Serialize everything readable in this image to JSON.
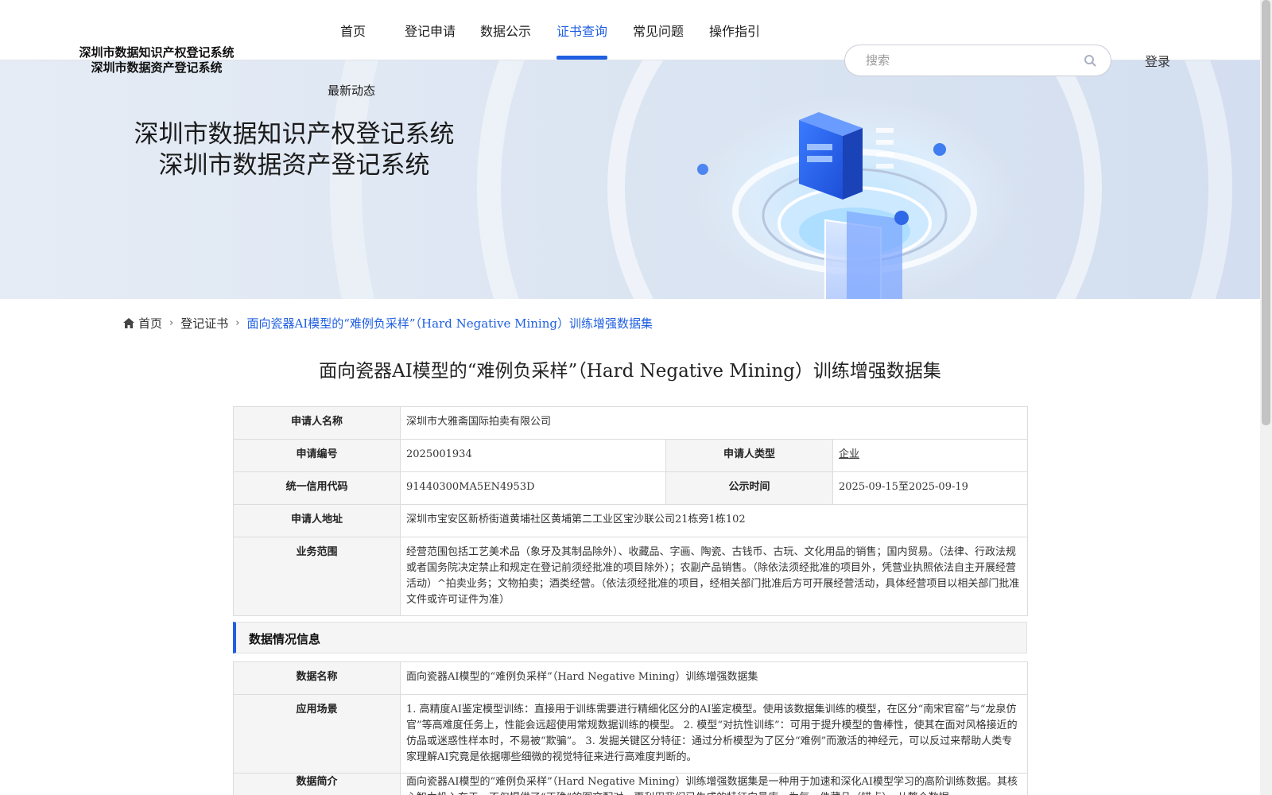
{
  "header": {
    "logo_line1": "深圳市数据知识产权登记系统",
    "logo_line2": "深圳市数据资产登记系统",
    "nav": [
      {
        "label": "首页"
      },
      {
        "label": "登记申请"
      },
      {
        "label": "数据公示"
      },
      {
        "label": "证书查询",
        "active": true
      },
      {
        "label": "常见问题"
      },
      {
        "label": "操作指引"
      }
    ],
    "nav_news": "最新动态",
    "search_placeholder": "搜索",
    "login": "登录"
  },
  "banner": {
    "title_line1": "深圳市数据知识产权登记系统",
    "title_line2": "深圳市数据资产登记系统"
  },
  "breadcrumb": {
    "home": "首页",
    "level2": "登记证书",
    "current": "面向瓷器AI模型的“难例负采样”（Hard Negative Mining）训练增强数据集"
  },
  "title": "面向瓷器AI模型的“难例负采样”（Hard Negative Mining）训练增强数据集",
  "applicant": {
    "name_label": "申请人名称",
    "name": "深圳市大雅斋国际拍卖有限公司",
    "number_label": "申请编号",
    "number": "2025001934",
    "type_label": "申请人类型",
    "type": "企业",
    "credit_label": "统一信用代码",
    "credit": "91440300MA5EN4953D",
    "publicity_label": "公示时间",
    "publicity": "2025-09-15至2025-09-19",
    "address_label": "申请人地址",
    "address": "深圳市宝安区新桥街道黄埔社区黄埔第二工业区宝沙联公司21栋旁1栋102",
    "scope_label": "业务范围",
    "scope": "经营范围包括工艺美术品（象牙及其制品除外）、收藏品、字画、陶瓷、古钱币、古玩、文化用品的销售；国内贸易。（法律、行政法规或者国务院决定禁止和规定在登记前须经批准的项目除外）；农副产品销售。（除依法须经批准的项目外，凭营业执照依法自主开展经营活动）^拍卖业务；文物拍卖；酒类经营。（依法须经批准的项目，经相关部门批准后方可开展经营活动，具体经营项目以相关部门批准文件或许可证件为准）"
  },
  "section": {
    "title": "数据情况信息"
  },
  "data_info": {
    "name_label": "数据名称",
    "name": "面向瓷器AI模型的“难例负采样”（Hard Negative Mining）训练增强数据集",
    "scene_label": "应用场景",
    "scene": "1. 高精度AI鉴定模型训练：直接用于训练需要进行精细化区分的AI鉴定模型。使用该数据集训练的模型，在区分“南宋官窑”与“龙泉仿官”等高难度任务上，性能会远超使用常规数据训练的模型。 2. 模型“对抗性训练”：可用于提升模型的鲁棒性，使其在面对风格接近的仿品或迷惑性样本时，不易被“欺骗”。 3. 发掘关键区分特征：通过分析模型为了区分“难例”而激活的神经元，可以反过来帮助人类专家理解AI究竟是依据哪些细微的视觉特征来进行高难度判断的。",
    "intro_label": "数据简介",
    "intro": "面向瓷器AI模型的“难例负采样”（Hard Negative Mining）训练增强数据集是一种用于加速和深化AI模型学习的高阶训练数据。其核心智力投入在于，不仅提供了“正确”的图文配对，更利用我们已生成的特征向量库，为每一件藏品（锚点），从整个数据"
  }
}
